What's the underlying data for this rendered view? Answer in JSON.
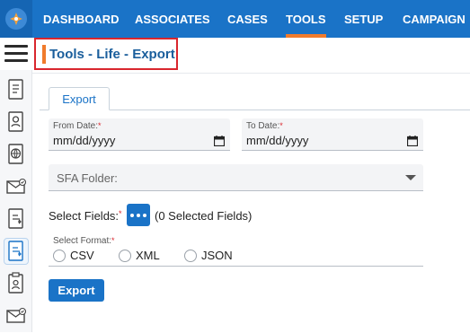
{
  "nav": {
    "items": [
      {
        "label": "DASHBOARD",
        "active": false
      },
      {
        "label": "ASSOCIATES",
        "active": false
      },
      {
        "label": "CASES",
        "active": false
      },
      {
        "label": "TOOLS",
        "active": true
      },
      {
        "label": "SETUP",
        "active": false
      },
      {
        "label": "CAMPAIGN",
        "active": false
      }
    ],
    "accent_color": "#f07b2c",
    "bar_color": "#1a73c7"
  },
  "sidebar": {
    "icons": [
      "document-icon",
      "contact-card-icon",
      "globe-document-icon",
      "mail-check-icon",
      "document-export-icon",
      "document-export-active-icon",
      "clipboard-icon",
      "mail-check-icon"
    ]
  },
  "header": {
    "title": "Tools - Life - Export"
  },
  "tabs": [
    {
      "label": "Export"
    }
  ],
  "form": {
    "from_date": {
      "label": "From Date:",
      "required_mark": "*",
      "value": "mm/dd/yyyy"
    },
    "to_date": {
      "label": "To Date:",
      "required_mark": "*",
      "value": "mm/dd/yyyy"
    },
    "sfa_folder": {
      "label": "SFA Folder:"
    },
    "select_fields": {
      "label": "Select Fields:",
      "required_mark": "*",
      "count_text": "(0 Selected Fields)"
    },
    "select_format": {
      "label": "Select Format:",
      "required_mark": "*",
      "options": [
        "CSV",
        "XML",
        "JSON"
      ]
    },
    "submit_label": "Export"
  }
}
